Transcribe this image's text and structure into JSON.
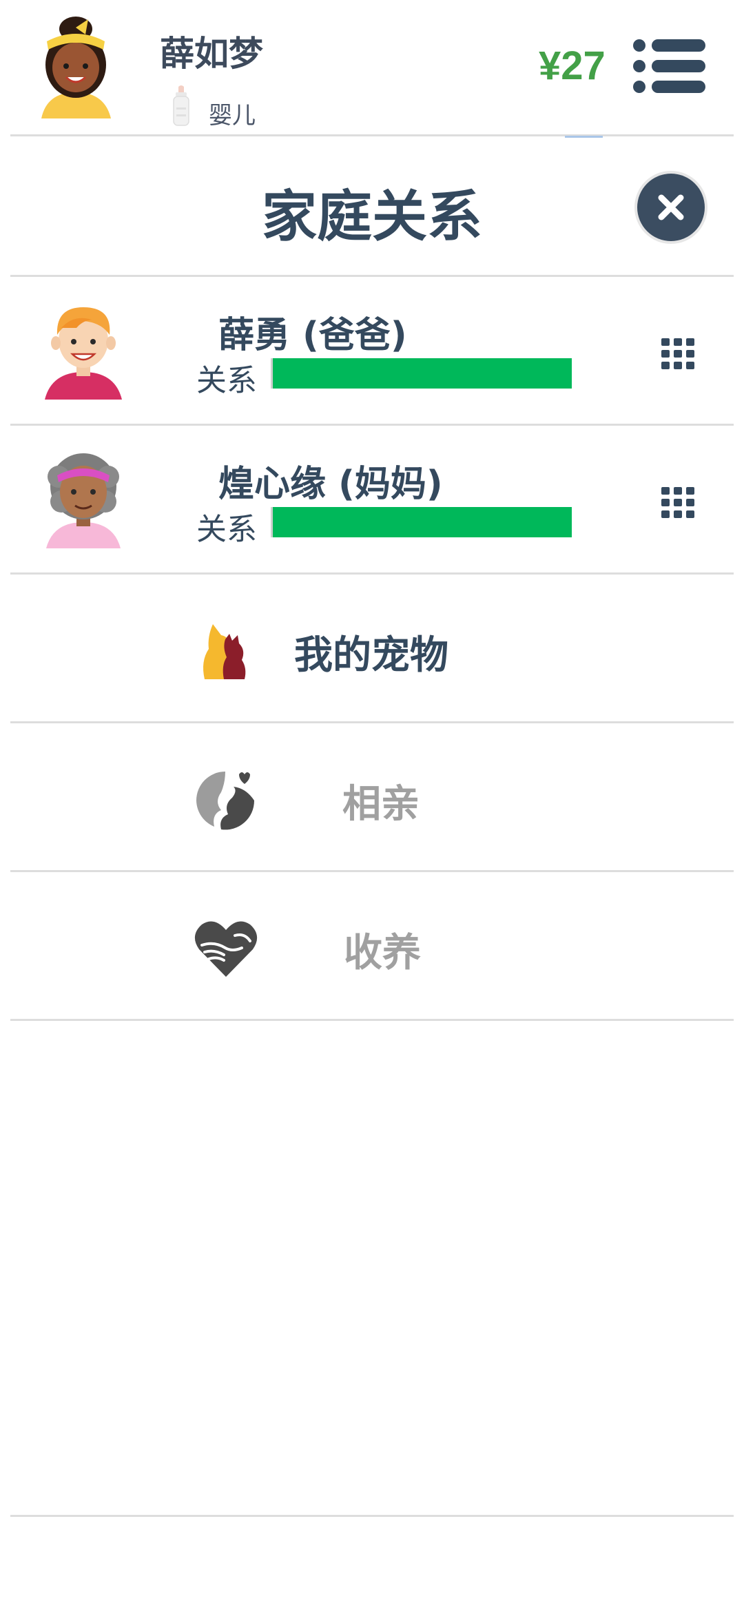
{
  "header": {
    "user_name": "薛如梦",
    "life_stage": "婴儿",
    "money": "¥27"
  },
  "panel": {
    "title": "家庭关系",
    "relations": [
      {
        "name": "薛勇 (爸爸)",
        "relation_label": "关系",
        "relationship_level": 1.0
      },
      {
        "name": "煌心缘 (妈妈)",
        "relation_label": "关系",
        "relationship_level": 1.0
      }
    ],
    "menu": [
      {
        "label": "我的宠物",
        "enabled": true
      },
      {
        "label": "相亲",
        "enabled": false
      },
      {
        "label": "收养",
        "enabled": false
      }
    ]
  },
  "colors": {
    "accent_dark": "#34495e",
    "money_green": "#43a047",
    "bar_green": "#00b85a",
    "disabled_text": "#a0a0a0"
  }
}
